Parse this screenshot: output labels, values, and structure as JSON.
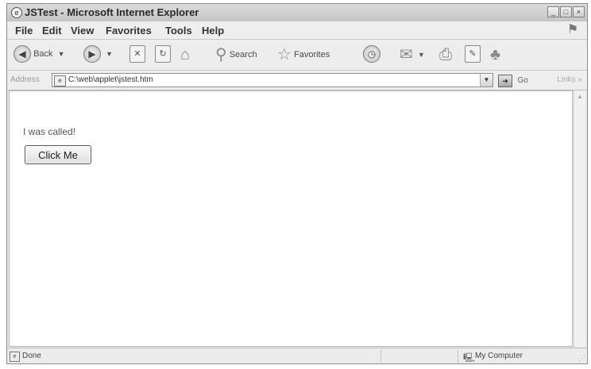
{
  "window": {
    "title": "JSTest - Microsoft Internet Explorer",
    "controls": {
      "minimize": "_",
      "maximize": "□",
      "close": "×"
    }
  },
  "menu": {
    "items": [
      "File",
      "Edit",
      "View",
      "Favorites",
      "Tools",
      "Help"
    ]
  },
  "toolbar": {
    "back_label": "Back",
    "search_label": "Search",
    "favorites_label": "Favorites"
  },
  "address": {
    "label": "Address",
    "value": "C:\\web\\applet\\jstest.htm",
    "go_label": "Go",
    "links_label": "Links"
  },
  "page": {
    "message": "I was called!",
    "button_label": "Click Me"
  },
  "status": {
    "text": "Done",
    "zone": "My Computer"
  }
}
